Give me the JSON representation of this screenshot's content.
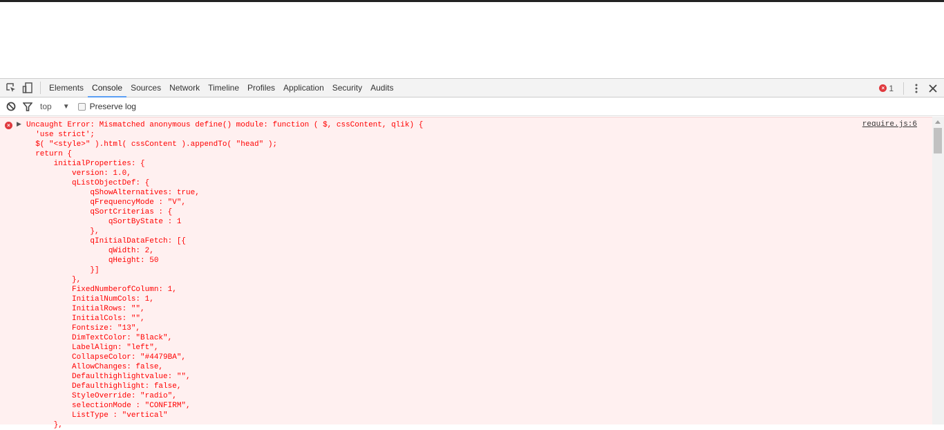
{
  "devtools": {
    "tabs": [
      "Elements",
      "Console",
      "Sources",
      "Network",
      "Timeline",
      "Profiles",
      "Application",
      "Security",
      "Audits"
    ],
    "active_tab": "Console",
    "error_count": "1"
  },
  "console_toolbar": {
    "context": "top",
    "preserve_log_label": "Preserve log"
  },
  "message": {
    "source": "require.js:6",
    "lines": [
      "Uncaught Error: Mismatched anonymous define() module: function ( $, cssContent, qlik) {",
      "  'use strict';",
      "  $( \"<style>\" ).html( cssContent ).appendTo( \"head\" );",
      "  return {",
      "      initialProperties: {",
      "          version: 1.0,",
      "          qListObjectDef: {",
      "              qShowAlternatives: true,",
      "              qFrequencyMode : \"V\",",
      "              qSortCriterias : {",
      "                  qSortByState : 1",
      "              },",
      "              qInitialDataFetch: [{",
      "                  qWidth: 2,",
      "                  qHeight: 50",
      "              }]",
      "          },",
      "          FixedNumberofColumn: 1,",
      "          InitialNumCols: 1,",
      "          InitialRows: \"\",",
      "          InitialCols: \"\",",
      "          Fontsize: \"13\",",
      "          DimTextColor: \"Black\",",
      "          LabelAlign: \"left\",",
      "          CollapseColor: \"#4479BA\",",
      "          AllowChanges: false,",
      "          Defaulthighlightvalue: \"\",",
      "          Defaulthighlight: false,",
      "          StyleOverride: \"radio\",",
      "          selectionMode : \"CONFIRM\",",
      "          ListType : \"vertical\"",
      "      },"
    ]
  }
}
